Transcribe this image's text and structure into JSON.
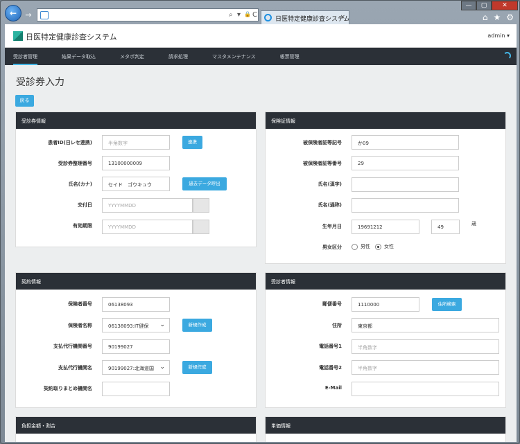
{
  "browser": {
    "tab_title": "日医特定健康診査システム",
    "tab_close": "×",
    "addr_symbols": [
      "⌕",
      "▾",
      "🔒",
      "C"
    ],
    "window_buttons": [
      "—",
      "▢",
      "✕"
    ],
    "tool_icons": [
      "home-icon",
      "star-icon",
      "gear-icon"
    ],
    "tool_glyphs": [
      "⌂",
      "★",
      "⚙"
    ]
  },
  "app": {
    "title": "日医特定健康診査システム",
    "user": "admin ▾"
  },
  "menu": [
    "受診者管理",
    "結果データ取込",
    "メタボ判定",
    "請求処理",
    "マスタメンテナンス",
    "帳票管理"
  ],
  "page": {
    "title": "受診券入力",
    "back_label": "戻る"
  },
  "ticket": {
    "header": "受診券情報",
    "patient_id_label": "患者ID(日レセ連携)",
    "patient_id_placeholder": "半角数字",
    "link_button": "連携",
    "ticket_no_label": "受診券整理番号",
    "ticket_no_value": "13100000009",
    "name_kana_label": "氏名(カナ)",
    "name_kana_value": "セイド　ゴウキュウ",
    "past_data_button": "過去データ呼出",
    "issue_date_label": "交付日",
    "issue_date_placeholder": "YYYYMMDD",
    "expiry_label": "有効期限",
    "expiry_placeholder": "YYYYMMDD"
  },
  "insurance": {
    "header": "保険証情報",
    "symbol_label": "被保険者証等記号",
    "symbol_value": "か09",
    "number_label": "被保険者証等番号",
    "number_value": "29",
    "name_kanji_label": "氏名(漢字)",
    "name_kanji_value": "",
    "name_roman_label": "氏名(通称)",
    "name_roman_value": "",
    "birth_label": "生年月日",
    "birth_value": "19691212",
    "age_value": "49",
    "age_unit": "歳",
    "sex_label": "男女区分",
    "sex_male": "男性",
    "sex_female": "女性",
    "sex_selected": "female"
  },
  "contract": {
    "header": "契約情報",
    "insurer_no_label": "保険者番号",
    "insurer_no_value": "06138093",
    "insurer_name_label": "保険者名称",
    "insurer_name_value": "06138093:IT健保",
    "new_button_1": "新規作成",
    "agency_no_label": "支払代行機関番号",
    "agency_no_value": "90199027",
    "agency_name_label": "支払代行機関名",
    "agency_name_value": "90199027:北海道国",
    "new_button_2": "新規作成",
    "summary_label": "契約取りまとめ機関名",
    "summary_value": ""
  },
  "examinee": {
    "header": "受診者情報",
    "zip_label": "郵便番号",
    "zip_value": "1110000",
    "address_search_button": "住所検索",
    "address_label": "住所",
    "address_value": "東京都",
    "phone1_label": "電話番号1",
    "phone1_placeholder": "半角数字",
    "phone2_label": "電話番号2",
    "phone2_placeholder": "半角数字",
    "email_label": "E-Mail",
    "email_value": ""
  },
  "bottom": {
    "left_header": "負担金額・割合",
    "right_header": "単価情報"
  },
  "colors": {
    "accent": "#3ba9e0",
    "header_dark": "#2b3037",
    "page_bg": "#eceeef"
  }
}
